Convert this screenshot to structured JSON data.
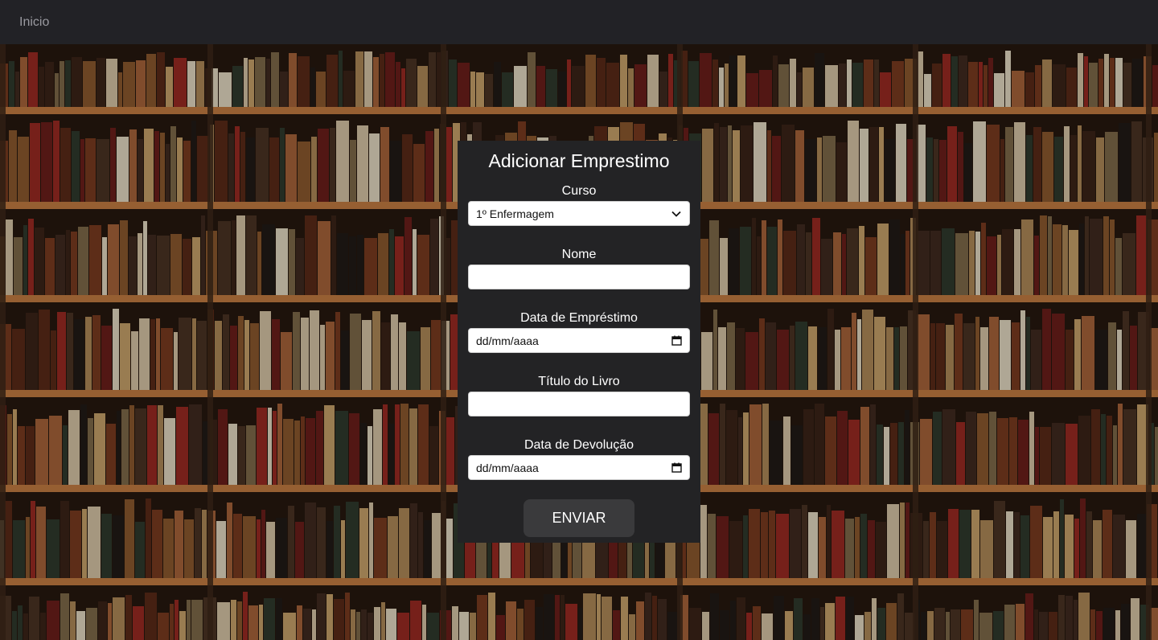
{
  "nav": {
    "home_label": "Inicio"
  },
  "form": {
    "title": "Adicionar Emprestimo",
    "course": {
      "label": "Curso",
      "selected": "1º Enfermagem"
    },
    "name": {
      "label": "Nome",
      "value": ""
    },
    "loan_date": {
      "label": "Data de Empréstimo",
      "placeholder": "dd/mm/aaaa"
    },
    "book_title": {
      "label": "Título do Livro",
      "value": ""
    },
    "return_date": {
      "label": "Data de Devolução",
      "placeholder": "dd/mm/aaaa"
    },
    "submit_label": "ENVIAR"
  },
  "icons": {
    "select_arrow": "chevron-down-icon",
    "date_picker": "calendar-icon"
  },
  "colors": {
    "navbar": "#222226",
    "panel": "#232325",
    "button": "#3a3a3c",
    "text": "#ffffff"
  }
}
